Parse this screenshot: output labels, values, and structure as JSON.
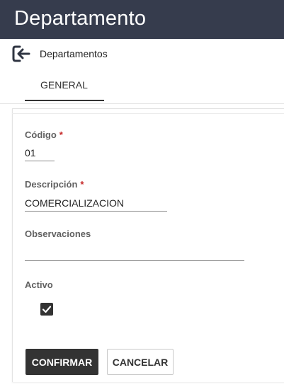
{
  "header": {
    "title": "Departamento"
  },
  "nav": {
    "back_label": "Departamentos"
  },
  "tabs": [
    {
      "label": "GENERAL"
    }
  ],
  "form": {
    "codigo": {
      "label": "Código",
      "required": "*",
      "value": "01"
    },
    "descripcion": {
      "label": "Descripción",
      "required": "*",
      "value": "COMERCIALIZACION"
    },
    "observaciones": {
      "label": "Observaciones",
      "value": ""
    },
    "activo": {
      "label": "Activo",
      "checked": true
    }
  },
  "actions": {
    "confirm_label": "CONFIRMAR",
    "cancel_label": "CANCELAR"
  },
  "colors": {
    "header_bg": "#363c4d",
    "primary_button": "#333333",
    "required_mark": "#c62828"
  }
}
